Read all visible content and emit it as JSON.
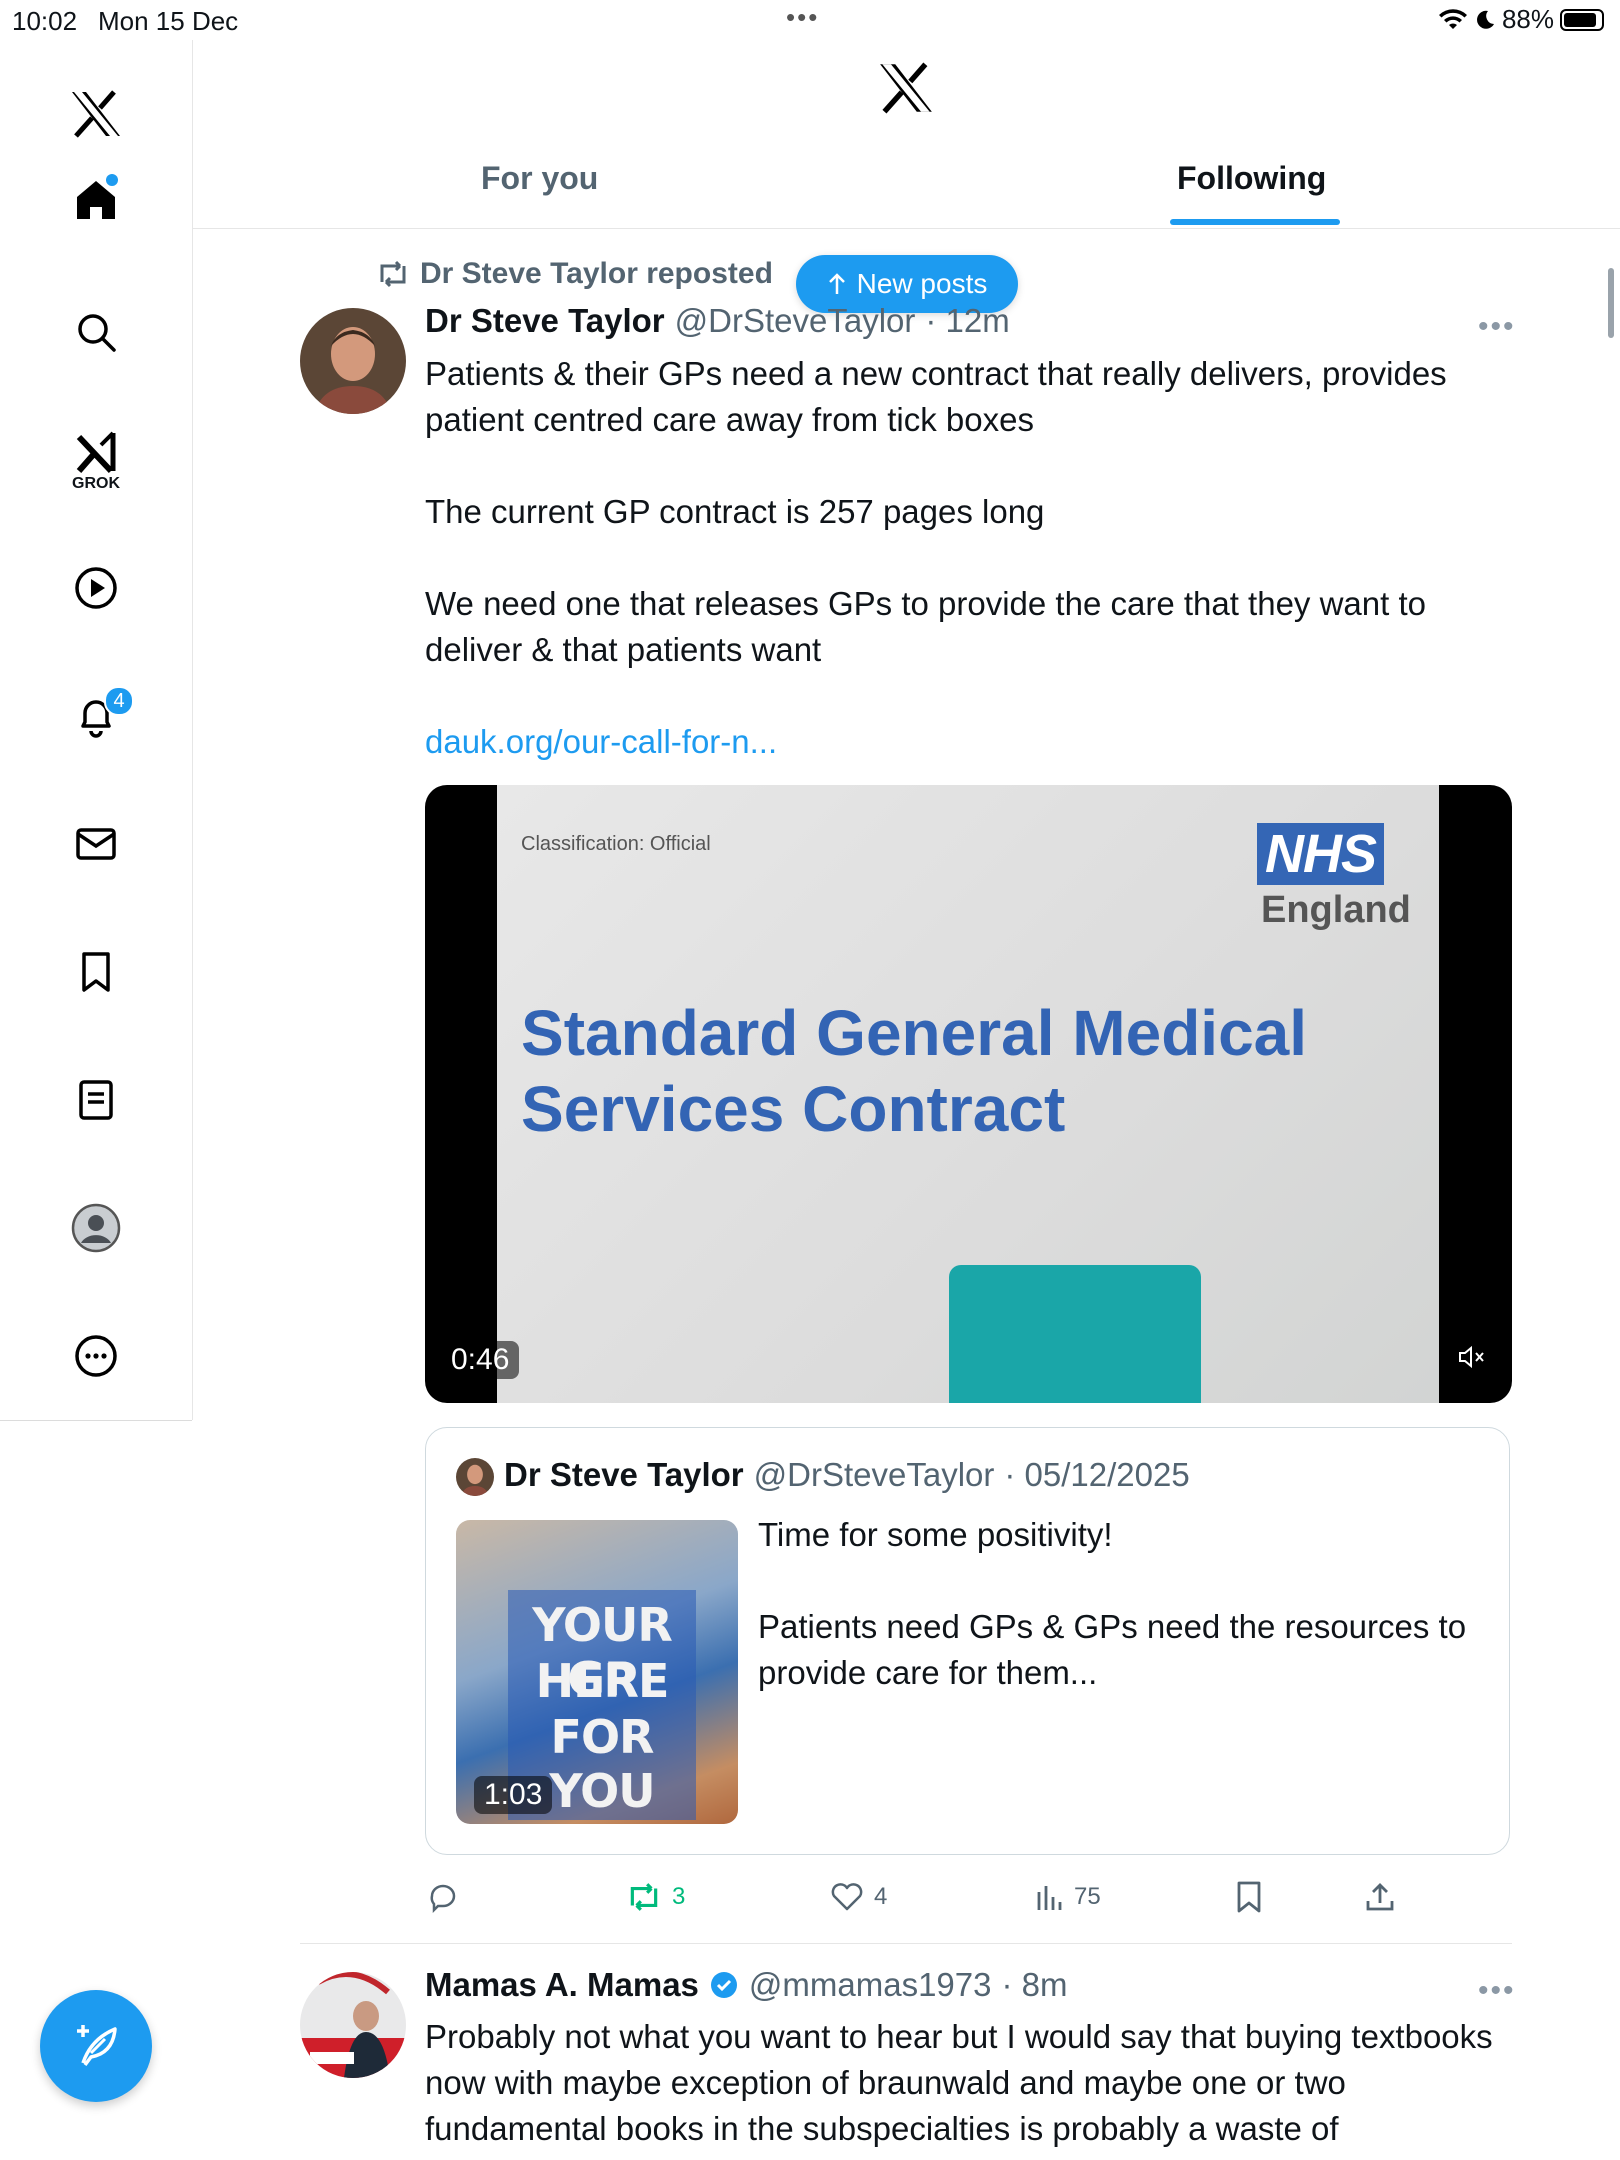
{
  "status_bar": {
    "time": "10:02",
    "date": "Mon 15 Dec",
    "battery": "88%"
  },
  "sidebar": {
    "items": [
      {
        "name": "home",
        "icon": "home-icon"
      },
      {
        "name": "search",
        "icon": "search-icon"
      },
      {
        "name": "grok",
        "icon": "grok-icon",
        "label": "GROK"
      },
      {
        "name": "video",
        "icon": "play-icon"
      },
      {
        "name": "notifications",
        "icon": "bell-icon",
        "badge": "4"
      },
      {
        "name": "messages",
        "icon": "mail-icon"
      },
      {
        "name": "bookmarks",
        "icon": "bookmark-icon"
      },
      {
        "name": "lists",
        "icon": "list-icon"
      },
      {
        "name": "profile",
        "icon": "profile-icon"
      },
      {
        "name": "more",
        "icon": "more-circle-icon"
      }
    ]
  },
  "header": {
    "tabs": [
      {
        "label": "For you",
        "active": false
      },
      {
        "label": "Following",
        "active": true
      }
    ]
  },
  "new_posts": {
    "label": "New posts"
  },
  "post1": {
    "repost_label": "Dr Steve Taylor reposted",
    "author": "Dr Steve Taylor",
    "handle": "@DrSteveTaylor",
    "time": "· 12m",
    "text": [
      "Patients & their GPs need a new contract that really delivers, provides patient centred care away from tick boxes",
      "The current GP contract is 257 pages long",
      "We need one that releases GPs to provide the care that they want to deliver & that patients want"
    ],
    "link": "dauk.org/our-call-for-n...",
    "video": {
      "classification": "Classification: Official",
      "nhs": "NHS",
      "england": "England",
      "title_line1": "Standard General Medical",
      "title_line2": "Services Contract",
      "duration": "0:46"
    },
    "quote": {
      "author": "Dr Steve Taylor",
      "handle": "@DrSteveTaylor",
      "date": "· 05/12/2025",
      "thumb_line1": "YOUR GP",
      "thumb_line2": "HERE",
      "thumb_line3": "FOR YOU",
      "thumb_duration": "1:03",
      "text1": "Time for some positivity!",
      "text2": "Patients need GPs & GPs need the resources to provide care for them..."
    },
    "actions": {
      "replies": "",
      "reposts": "3",
      "likes": "4",
      "views": "75"
    }
  },
  "post2": {
    "author": "Mamas A. Mamas",
    "handle": "@mmamas1973",
    "time": "· 8m",
    "text": "Probably not what you want to hear but I would say that buying textbooks now with maybe exception of braunwald and maybe one or two fundamental books in the subspecialties is probably a waste of"
  },
  "colors": {
    "accent": "#1d9bf0",
    "repost_green": "#00ba7c",
    "text": "#0f1419",
    "muted": "#536471"
  }
}
